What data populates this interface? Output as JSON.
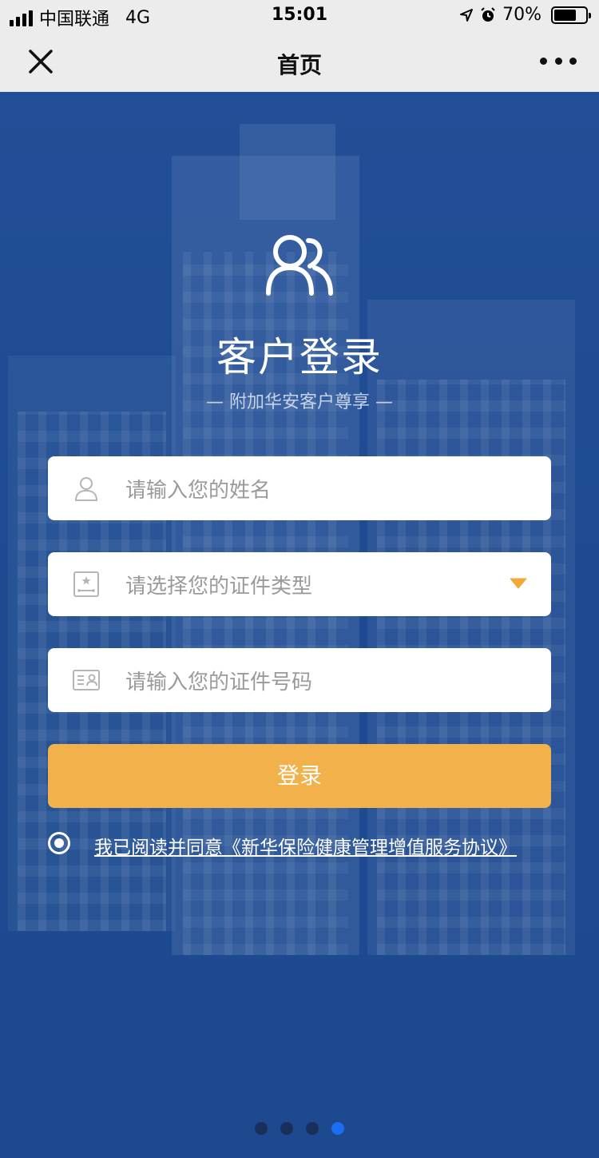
{
  "status_bar": {
    "carrier": "中国联通",
    "network": "4G",
    "time": "15:01",
    "battery_percent": "70%",
    "battery_level": 0.7,
    "icons": [
      "signal-icon",
      "location-arrow-icon",
      "alarm-icon",
      "battery-icon"
    ]
  },
  "nav": {
    "title": "首页",
    "close_icon": "close-icon",
    "more_icon": "more-dots-icon"
  },
  "login": {
    "title": "客户登录",
    "subtitle": "— 附加华安客户尊享 —",
    "name_placeholder": "请输入您的姓名",
    "id_type_placeholder": "请选择您的证件类型",
    "id_number_placeholder": "请输入您的证件号码",
    "button_label": "登录",
    "agreement_text": "我已阅读并同意《新华保险健康管理增值服务协议》",
    "agreement_checked": true
  },
  "pager": {
    "count": 4,
    "active_index": 3
  },
  "colors": {
    "background": "#1f4a91",
    "button": "#f3b14c",
    "dropdown_arrow": "#f3a93a",
    "pager_active": "#1a6ff0"
  }
}
